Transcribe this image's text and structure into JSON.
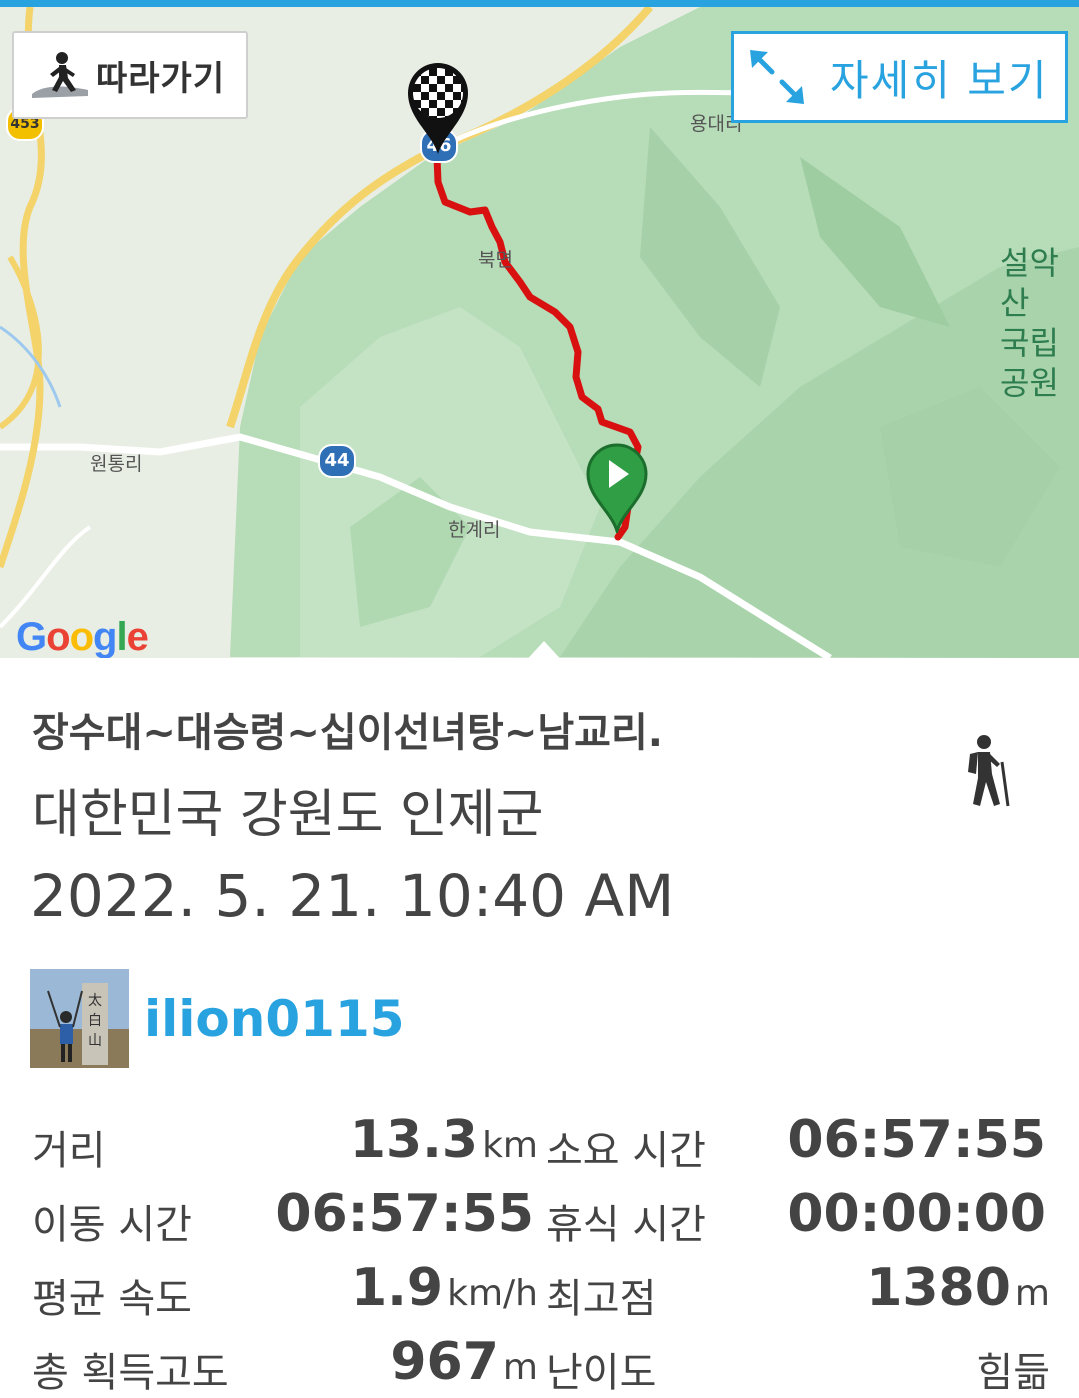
{
  "map": {
    "follow_label": "따라가기",
    "detail_label": "자세히 보기",
    "place_labels": {
      "yongdae": "용대리",
      "bukmeok": "북면",
      "wontong": "원통리",
      "hangye": "한계리",
      "park_line1": "설악산",
      "park_line2": "국립공원"
    },
    "road_numbers": {
      "r46": "46",
      "r44": "44",
      "r453": "453"
    },
    "google_logo": [
      "G",
      "o",
      "o",
      "g",
      "l",
      "e"
    ],
    "route_color": "#d81010",
    "accent_color": "#29a3e0"
  },
  "track": {
    "title": "장수대~대승령~십이선녀탕~남교리.",
    "region": "대한민국 강원도 인제군",
    "datetime": "2022. 5. 21. 10:40 AM",
    "activity_icon": "hiking-icon",
    "username": "ilion0115"
  },
  "stats": {
    "distance_label": "거리",
    "distance_value": "13.3",
    "distance_unit": "km",
    "duration_label": "소요 시간",
    "duration_value": "06:57:55",
    "moving_label": "이동 시간",
    "moving_value": "06:57:55",
    "rest_label": "휴식 시간",
    "rest_value": "00:00:00",
    "avg_speed_label": "평균 속도",
    "avg_speed_value": "1.9",
    "avg_speed_unit": "km/h",
    "max_elev_label": "최고점",
    "max_elev_value": "1380",
    "max_elev_unit": "m",
    "gain_label": "총 획득고도",
    "gain_value": "967",
    "gain_unit": "m",
    "difficulty_label": "난이도",
    "difficulty_value": "힘듦"
  }
}
